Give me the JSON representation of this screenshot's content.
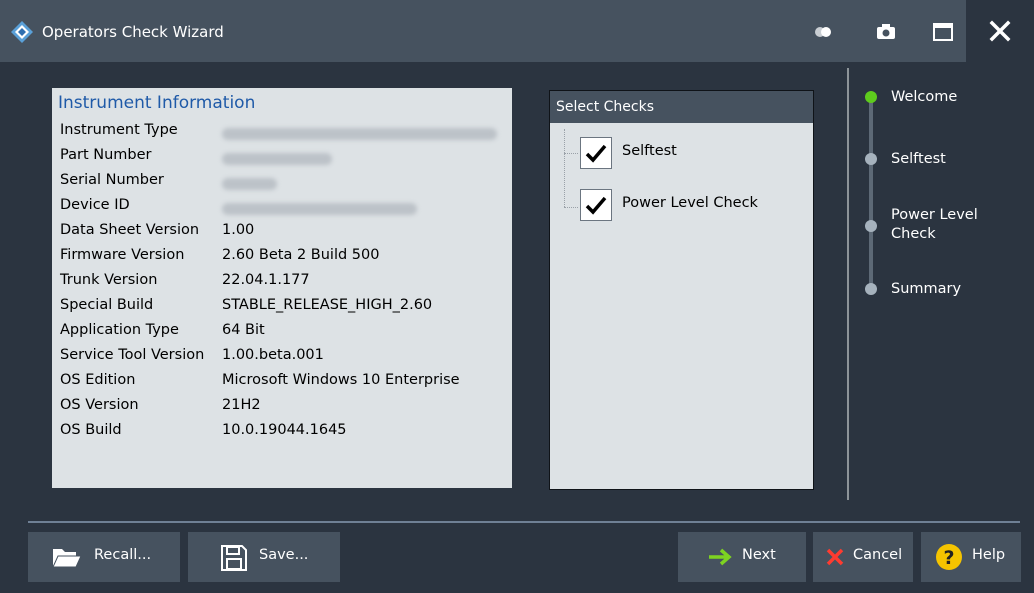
{
  "window": {
    "title": "Operators Check Wizard"
  },
  "instrument_info": {
    "title": "Instrument Information",
    "rows": [
      {
        "label": "Instrument Type",
        "value": null
      },
      {
        "label": "Part Number",
        "value": null
      },
      {
        "label": "Serial Number",
        "value": null
      },
      {
        "label": "Device ID",
        "value": null
      },
      {
        "label": "Data Sheet Version",
        "value": "1.00"
      },
      {
        "label": "Firmware Version",
        "value": "2.60 Beta 2 Build 500"
      },
      {
        "label": "Trunk Version",
        "value": "22.04.1.177"
      },
      {
        "label": "Special Build",
        "value": "STABLE_RELEASE_HIGH_2.60"
      },
      {
        "label": "Application Type",
        "value": "64 Bit"
      },
      {
        "label": "Service Tool Version",
        "value": "1.00.beta.001"
      },
      {
        "label": "OS Edition",
        "value": "Microsoft Windows 10 Enterprise"
      },
      {
        "label": "OS Version",
        "value": "21H2"
      },
      {
        "label": "OS Build",
        "value": "10.0.19044.1645"
      }
    ]
  },
  "checks": {
    "title": "Select Checks",
    "items": [
      {
        "label": "Selftest",
        "checked": true
      },
      {
        "label": "Power Level Check",
        "checked": true
      }
    ]
  },
  "steps": {
    "items": [
      {
        "label": "Welcome",
        "state": "active"
      },
      {
        "label": "Selftest",
        "state": "pending"
      },
      {
        "label": "Power Level Check",
        "state": "pending"
      },
      {
        "label": "Summary",
        "state": "pending"
      }
    ]
  },
  "buttons": {
    "recall": "Recall...",
    "save": "Save...",
    "next": "Next",
    "cancel": "Cancel",
    "help": "Help"
  },
  "colors": {
    "active_step": "#5ecb1d",
    "next_arrow": "#7ed321",
    "cancel_x": "#ff3b30",
    "help_circle": "#f5c400",
    "panel_title": "#1f5aa8"
  }
}
